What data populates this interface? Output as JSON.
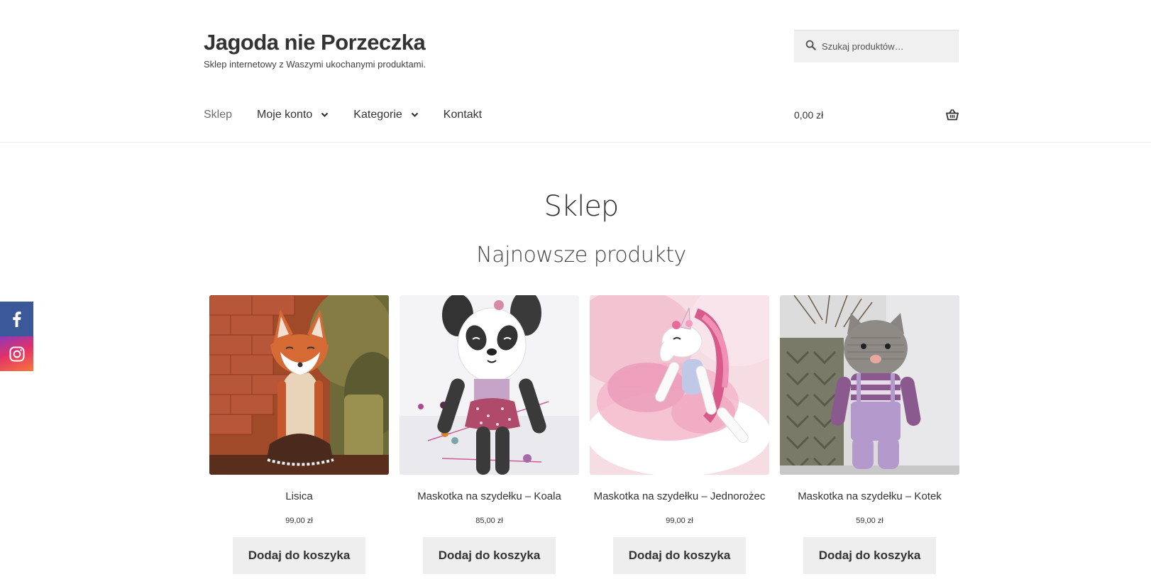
{
  "site": {
    "title": "Jagoda nie Porzeczka",
    "description": "Sklep internetowy z Waszymi ukochanymi produktami."
  },
  "search": {
    "placeholder": "Szukaj produktów…",
    "icon": "search-icon"
  },
  "nav": {
    "items": [
      {
        "label": "Sklep",
        "active": true,
        "has_dropdown": false
      },
      {
        "label": "Moje konto",
        "active": false,
        "has_dropdown": true
      },
      {
        "label": "Kategorie",
        "active": false,
        "has_dropdown": true
      },
      {
        "label": "Kontakt",
        "active": false,
        "has_dropdown": false
      }
    ]
  },
  "cart": {
    "total": "0,00 zł",
    "icon": "basket-icon"
  },
  "page": {
    "title": "Sklep",
    "section_title": "Najnowsze produkty"
  },
  "social": {
    "items": [
      {
        "name": "facebook",
        "icon": "facebook-icon",
        "color": "#3b5998"
      },
      {
        "name": "instagram",
        "icon": "instagram-icon",
        "color": "#e1306c"
      }
    ]
  },
  "products": [
    {
      "name": "Lisica",
      "price": "99,00 zł",
      "button": "Dodaj do koszyka"
    },
    {
      "name": "Maskotka na szydełku – Koala",
      "price": "85,00 zł",
      "button": "Dodaj do koszyka"
    },
    {
      "name": "Maskotka na szydełku – Jednorożec",
      "price": "99,00 zł",
      "button": "Dodaj do koszyka"
    },
    {
      "name": "Maskotka na szydełku – Kotek",
      "price": "59,00 zł",
      "button": "Dodaj do koszyka"
    }
  ]
}
